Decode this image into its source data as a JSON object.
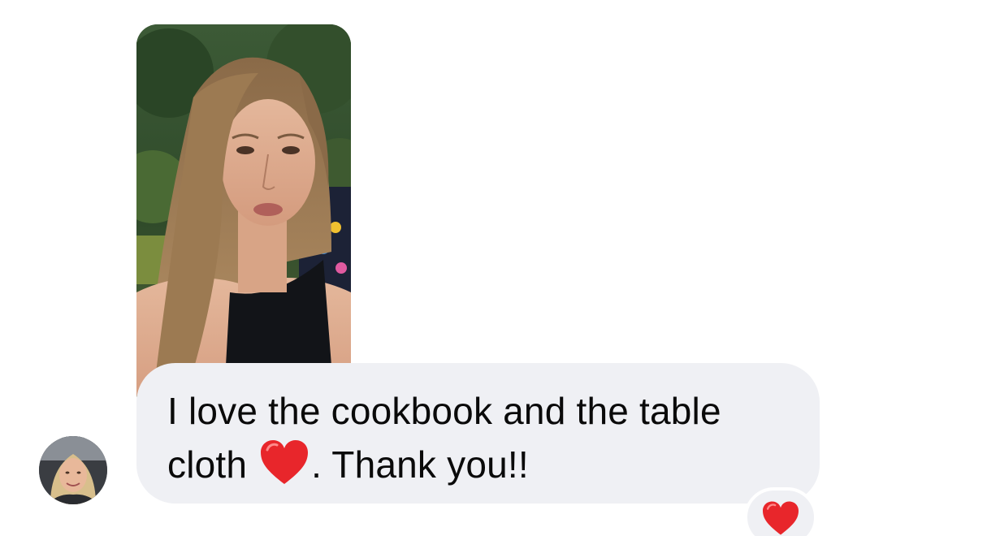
{
  "conversation": {
    "shared_media": {
      "kind": "video",
      "description_icon": "video-thumbnail"
    },
    "message": {
      "line1": "I love the cookbook and the table",
      "line2_before_emoji": "cloth ",
      "emoji": "red-heart-emoji",
      "line2_after_emoji": ". Thank you!!"
    },
    "reaction": {
      "emoji": "red-heart-emoji"
    },
    "sender": {
      "avatar_icon": "profile-photo"
    }
  },
  "colors": {
    "bubble_background": "#eff0f4",
    "text": "#0a0a0a",
    "heart": "#e8262b",
    "page_background": "#ffffff"
  }
}
